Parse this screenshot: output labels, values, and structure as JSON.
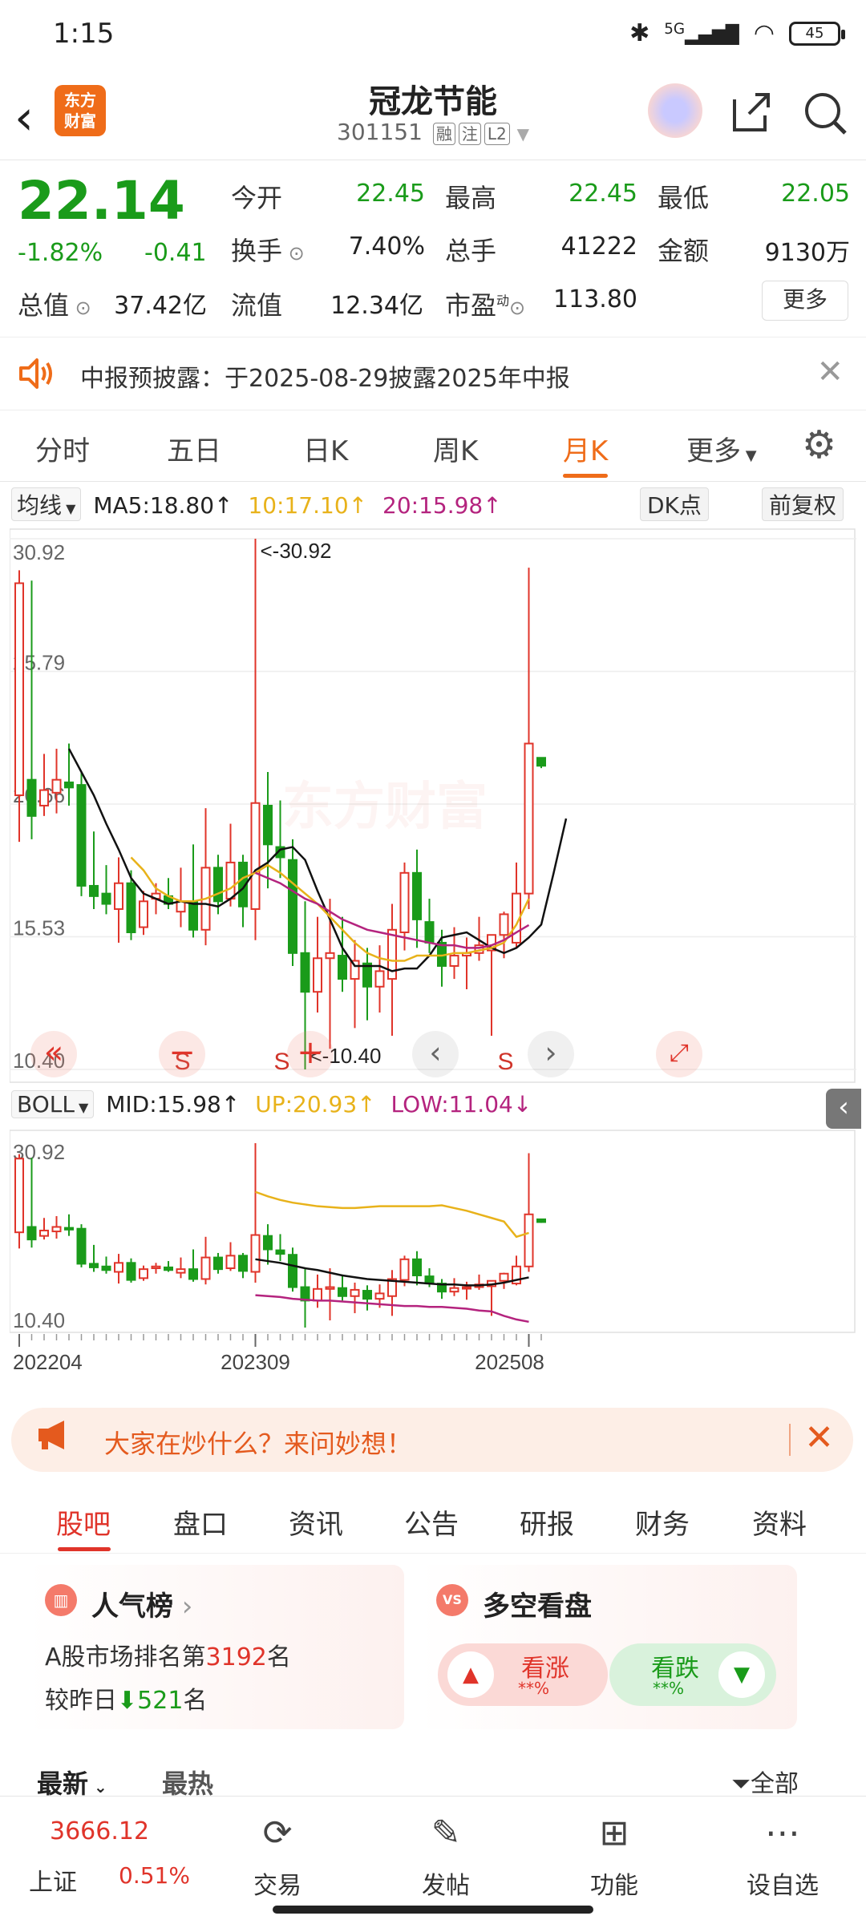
{
  "status": {
    "time": "1:15",
    "network": "5G",
    "battery": "45"
  },
  "header": {
    "logo_line1": "东方",
    "logo_line2": "财富",
    "name": "冠龙节能",
    "code": "301151",
    "tags": [
      "融",
      "注",
      "L2"
    ]
  },
  "quote": {
    "price": "22.14",
    "change_pct": "-1.82%",
    "change": "-0.41",
    "open_label": "今开",
    "open": "22.45",
    "high_label": "最高",
    "high": "22.45",
    "low_label": "最低",
    "low": "22.05",
    "turnover_label": "换手",
    "turnover": "7.40%",
    "volume_label": "总手",
    "volume": "41222",
    "amount_label": "金额",
    "amount": "9130万",
    "mktcap_label": "总值",
    "mktcap": "37.42亿",
    "float_label": "流值",
    "float": "12.34亿",
    "pe_label": "市盈",
    "pe_sup": "动",
    "pe": "113.80",
    "more": "更多"
  },
  "notice": {
    "text": "中报预披露：于2025-08-29披露2025年中报"
  },
  "period_tabs": [
    "分时",
    "五日",
    "日K",
    "周K",
    "月K",
    "更多"
  ],
  "active_period": "月K",
  "ma_row": {
    "selector": "均线",
    "ma5": "MA5:18.80↑",
    "ma10": "10:17.10↑",
    "ma20": "20:15.98↑",
    "dk": "DK点",
    "adjust": "前复权"
  },
  "boll_row": {
    "selector": "BOLL",
    "mid": "MID:15.98↑",
    "up": "UP:20.93↑",
    "low": "LOW:11.04↓"
  },
  "chart_data": [
    {
      "type": "candlestick",
      "title": "",
      "y_ticks": [
        "30.92",
        "25.79",
        "20.66",
        "15.53",
        "10.40"
      ],
      "ylim": [
        10.4,
        30.92
      ],
      "annotations": {
        "max": "<-30.92",
        "min": "<-10.40"
      },
      "watermark": "东方财富",
      "signal_markers": [
        "S",
        "S",
        "S"
      ],
      "candles": [
        {
          "o": 21.0,
          "h": 29.7,
          "l": 19.2,
          "c": 29.2
        },
        {
          "o": 21.6,
          "h": 29.3,
          "l": 19.3,
          "c": 20.2
        },
        {
          "o": 20.6,
          "h": 22.6,
          "l": 20.2,
          "c": 21.2
        },
        {
          "o": 21.1,
          "h": 22.8,
          "l": 20.3,
          "c": 21.6
        },
        {
          "o": 21.5,
          "h": 23.0,
          "l": 20.6,
          "c": 21.3
        },
        {
          "o": 21.4,
          "h": 21.9,
          "l": 17.1,
          "c": 17.5
        },
        {
          "o": 17.5,
          "h": 19.6,
          "l": 16.6,
          "c": 17.1
        },
        {
          "o": 17.2,
          "h": 18.3,
          "l": 16.4,
          "c": 16.8
        },
        {
          "o": 16.6,
          "h": 18.6,
          "l": 15.3,
          "c": 17.6
        },
        {
          "o": 17.6,
          "h": 18.1,
          "l": 15.4,
          "c": 15.7
        },
        {
          "o": 15.9,
          "h": 17.3,
          "l": 15.6,
          "c": 16.9
        },
        {
          "o": 17.0,
          "h": 17.6,
          "l": 16.4,
          "c": 17.2
        },
        {
          "o": 17.1,
          "h": 17.8,
          "l": 16.6,
          "c": 16.8
        },
        {
          "o": 16.5,
          "h": 18.2,
          "l": 15.9,
          "c": 16.9
        },
        {
          "o": 16.9,
          "h": 19.1,
          "l": 15.5,
          "c": 15.8
        },
        {
          "o": 15.8,
          "h": 20.5,
          "l": 15.2,
          "c": 18.2
        },
        {
          "o": 18.2,
          "h": 18.7,
          "l": 16.4,
          "c": 16.9
        },
        {
          "o": 17.0,
          "h": 19.9,
          "l": 16.7,
          "c": 18.4
        },
        {
          "o": 18.4,
          "h": 18.7,
          "l": 15.9,
          "c": 16.7
        },
        {
          "o": 16.6,
          "h": 30.92,
          "l": 15.4,
          "c": 20.7
        },
        {
          "o": 20.6,
          "h": 21.9,
          "l": 17.4,
          "c": 19.1
        },
        {
          "o": 19.0,
          "h": 20.8,
          "l": 17.8,
          "c": 18.6
        },
        {
          "o": 18.5,
          "h": 19.3,
          "l": 14.4,
          "c": 14.9
        },
        {
          "o": 14.9,
          "h": 16.9,
          "l": 10.4,
          "c": 13.4
        },
        {
          "o": 13.4,
          "h": 16.3,
          "l": 12.6,
          "c": 14.7
        },
        {
          "o": 14.7,
          "h": 17.0,
          "l": 11.2,
          "c": 14.9
        },
        {
          "o": 14.8,
          "h": 16.3,
          "l": 13.4,
          "c": 13.9
        },
        {
          "o": 13.9,
          "h": 15.4,
          "l": 12.0,
          "c": 14.6
        },
        {
          "o": 14.5,
          "h": 15.1,
          "l": 12.3,
          "c": 13.6
        },
        {
          "o": 13.6,
          "h": 15.2,
          "l": 12.6,
          "c": 14.2
        },
        {
          "o": 13.9,
          "h": 16.8,
          "l": 11.7,
          "c": 15.8
        },
        {
          "o": 15.7,
          "h": 18.4,
          "l": 15.0,
          "c": 18.0
        },
        {
          "o": 18.0,
          "h": 18.9,
          "l": 15.1,
          "c": 16.2
        },
        {
          "o": 16.1,
          "h": 17.0,
          "l": 14.9,
          "c": 15.3
        },
        {
          "o": 15.3,
          "h": 15.8,
          "l": 13.6,
          "c": 14.4
        },
        {
          "o": 14.4,
          "h": 15.9,
          "l": 13.9,
          "c": 14.8
        },
        {
          "o": 14.8,
          "h": 15.5,
          "l": 13.5,
          "c": 14.9
        },
        {
          "o": 14.9,
          "h": 16.3,
          "l": 14.6,
          "c": 15.2
        },
        {
          "o": 15.0,
          "h": 15.6,
          "l": 11.7,
          "c": 15.6
        },
        {
          "o": 15.6,
          "h": 16.5,
          "l": 14.7,
          "c": 16.4
        },
        {
          "o": 15.3,
          "h": 18.4,
          "l": 15.1,
          "c": 17.2
        },
        {
          "o": 17.2,
          "h": 29.8,
          "l": 16.6,
          "c": 23.0
        },
        {
          "o": 22.45,
          "h": 22.45,
          "l": 22.05,
          "c": 22.14
        }
      ],
      "ma": [
        {
          "name": "MA5",
          "color": "#111111",
          "start": 4,
          "values": [
            22.8,
            21.9,
            21.0,
            19.9,
            18.9,
            17.8,
            17.2,
            17.0,
            16.8,
            16.9,
            16.8,
            16.8,
            16.7,
            17.0,
            17.4,
            18.1,
            18.4,
            18.9,
            19.0,
            18.5,
            17.3,
            16.2,
            15.1,
            14.4,
            14.4,
            14.4,
            14.2,
            14.3,
            14.3,
            14.8,
            15.5,
            15.6,
            15.7,
            15.4,
            15.1,
            14.9,
            15.1,
            15.5,
            16.0,
            18.0,
            20.1
          ]
        },
        {
          "name": "MA10",
          "color": "#e8b21a",
          "start": 9,
          "values": [
            18.6,
            18.1,
            17.4,
            17.1,
            16.9,
            16.9,
            17.0,
            17.2,
            17.4,
            17.8,
            18.0,
            18.3,
            18.0,
            17.6,
            17.2,
            16.8,
            16.3,
            15.8,
            15.3,
            14.9,
            14.7,
            14.6,
            14.6,
            14.8,
            14.8,
            14.8,
            14.9,
            14.9,
            15.0,
            15.1,
            15.3,
            16.0,
            17.0
          ]
        },
        {
          "name": "MA20",
          "color": "#b4237e",
          "start": 19,
          "values": [
            18.0,
            17.8,
            17.6,
            17.3,
            17.0,
            16.8,
            16.5,
            16.2,
            16.0,
            15.8,
            15.7,
            15.6,
            15.5,
            15.4,
            15.3,
            15.2,
            15.2,
            15.1,
            15.1,
            15.2,
            15.4,
            15.7,
            15.98
          ]
        }
      ]
    },
    {
      "type": "boll",
      "y_ticks": [
        "30.92",
        "10.40"
      ],
      "ylim": [
        10.4,
        30.92
      ],
      "x_ticks": [
        "202204",
        "202309",
        "202508"
      ],
      "bands": [
        {
          "name": "UP",
          "color": "#e8b21a",
          "start": 19,
          "values": [
            25.5,
            25.0,
            24.6,
            24.3,
            24.1,
            23.9,
            23.8,
            23.7,
            23.7,
            23.8,
            23.9,
            23.9,
            23.9,
            23.9,
            23.9,
            24.0,
            23.7,
            23.4,
            23.0,
            22.6,
            22.2,
            20.5,
            20.93
          ]
        },
        {
          "name": "MID",
          "color": "#111111",
          "start": 19,
          "values": [
            18.0,
            17.8,
            17.6,
            17.3,
            17.0,
            16.8,
            16.5,
            16.2,
            16.0,
            15.8,
            15.7,
            15.6,
            15.5,
            15.4,
            15.3,
            15.2,
            15.2,
            15.1,
            15.1,
            15.2,
            15.4,
            15.7,
            15.98
          ]
        },
        {
          "name": "LOW",
          "color": "#b4237e",
          "start": 19,
          "values": [
            14.0,
            13.9,
            13.8,
            13.6,
            13.5,
            13.4,
            13.4,
            13.3,
            13.2,
            13.1,
            13.0,
            12.9,
            12.8,
            12.8,
            12.7,
            12.7,
            12.6,
            12.5,
            12.3,
            12.2,
            11.7,
            11.3,
            11.04
          ]
        }
      ]
    }
  ],
  "banner": {
    "text": "大家在炒什么？来问妙想！"
  },
  "main_tabs": [
    "股吧",
    "盘口",
    "资讯",
    "公告",
    "研报",
    "财务",
    "资料"
  ],
  "popularity": {
    "title": "人气榜",
    "line1_prefix": "A股市场排名第",
    "rank": "3192",
    "line1_suffix": "名",
    "line2_prefix": "较昨日",
    "delta": "521",
    "line2_suffix": "名"
  },
  "sentiment": {
    "title": "多空看盘",
    "up_label": "看涨",
    "up_value": "**%",
    "down_label": "看跌",
    "down_value": "**%"
  },
  "feed": {
    "newest": "最新",
    "hottest": "最热",
    "all": "全部"
  },
  "bottom_nav": {
    "index_value": "3666.12",
    "index_name": "上证",
    "index_change": "0.51%",
    "items": [
      "交易",
      "发帖",
      "功能",
      "设自选"
    ]
  },
  "colors": {
    "up": "#e0342a",
    "down": "#1a9b1a",
    "accent": "#ef6c19"
  }
}
